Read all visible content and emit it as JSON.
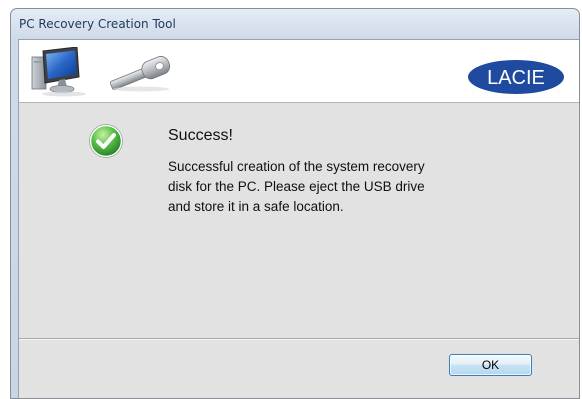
{
  "window": {
    "title": "PC Recovery Creation Tool"
  },
  "header": {
    "left_icons": [
      "computer-monitor-icon",
      "usb-key-icon"
    ],
    "logo_text": "LACIE"
  },
  "message": {
    "icon": "success-check-icon",
    "title": "Success!",
    "body_lines": [
      "Successful creation of the system recovery",
      "disk for the PC. Please eject the USB drive",
      "and store it in a safe location."
    ]
  },
  "footer": {
    "ok_label": "OK"
  },
  "colors": {
    "logo_blue": "#1e4aa0",
    "check_green": "#3ca83a",
    "button_border": "#3c7fb1"
  }
}
